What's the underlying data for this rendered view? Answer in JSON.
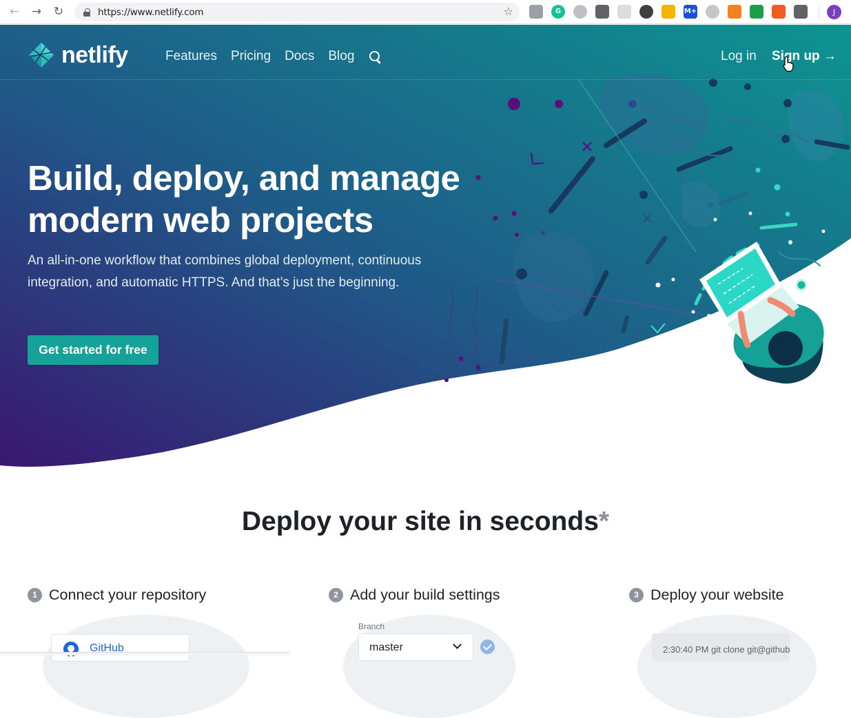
{
  "browser": {
    "url": "https://www.netlify.com",
    "profile_initial": "J",
    "icons": {
      "back": "back-arrow-icon",
      "forward": "forward-arrow-icon",
      "reload": "reload-icon",
      "lock": "lock-icon",
      "star": "star-icon"
    },
    "extensions": [
      {
        "name": "extension-wave-icon",
        "glyph": "",
        "color": "#9aa0a6"
      },
      {
        "name": "extension-grammarly-icon",
        "glyph": "G",
        "color": "#15c39a"
      },
      {
        "name": "extension-gray-circle-icon",
        "glyph": "",
        "color": "#bdc1c6"
      },
      {
        "name": "extension-vue-icon",
        "glyph": "",
        "color": "#5f6368"
      },
      {
        "name": "extension-grid-icon",
        "glyph": "",
        "color": "#dadce0"
      },
      {
        "name": "extension-brackets-icon",
        "glyph": "",
        "color": "#3c4043"
      },
      {
        "name": "extension-moon-icon",
        "glyph": "",
        "color": "#f4b400"
      },
      {
        "name": "extension-m-plus-icon",
        "glyph": "M+",
        "color": "#1a4fd6"
      },
      {
        "name": "extension-clock-icon",
        "glyph": "",
        "color": "#c4c7ca"
      },
      {
        "name": "extension-orange-icon",
        "glyph": "",
        "color": "#f6821f"
      },
      {
        "name": "extension-green-arrow-icon",
        "glyph": "",
        "color": "#1e9e4a"
      },
      {
        "name": "extension-orange-square-icon",
        "glyph": "",
        "color": "#f25a22"
      },
      {
        "name": "extension-glasses-icon",
        "glyph": "",
        "color": "#5f6368"
      }
    ]
  },
  "site": {
    "logo_text": "netlify",
    "nav": [
      "Features",
      "Pricing",
      "Docs",
      "Blog"
    ],
    "login": "Log in",
    "signup": "Sign up →"
  },
  "hero": {
    "headline": "Build, deploy, and manage modern web projects",
    "subtitle": "An all-in-one workflow that combines global deployment, continuous integration, and automatic HTTPS. And that’s just the beginning.",
    "cta": "Get started for free"
  },
  "deploy": {
    "title": "Deploy your site in seconds",
    "asterisk": "*",
    "steps": [
      {
        "num": "1",
        "label": "Connect your repository"
      },
      {
        "num": "2",
        "label": "Add your build settings"
      },
      {
        "num": "3",
        "label": "Deploy your website"
      }
    ],
    "provider": "GitHub",
    "branch_label": "Branch",
    "branch_value": "master",
    "terminal_line": "2:30:40 PM git clone git@github"
  },
  "colors": {
    "gradient_start": "#3a1770",
    "gradient_mid": "#1f5f8b",
    "gradient_end": "#0e8f8d",
    "cta": "#15a399",
    "accent_teal": "#3ad6c6"
  }
}
